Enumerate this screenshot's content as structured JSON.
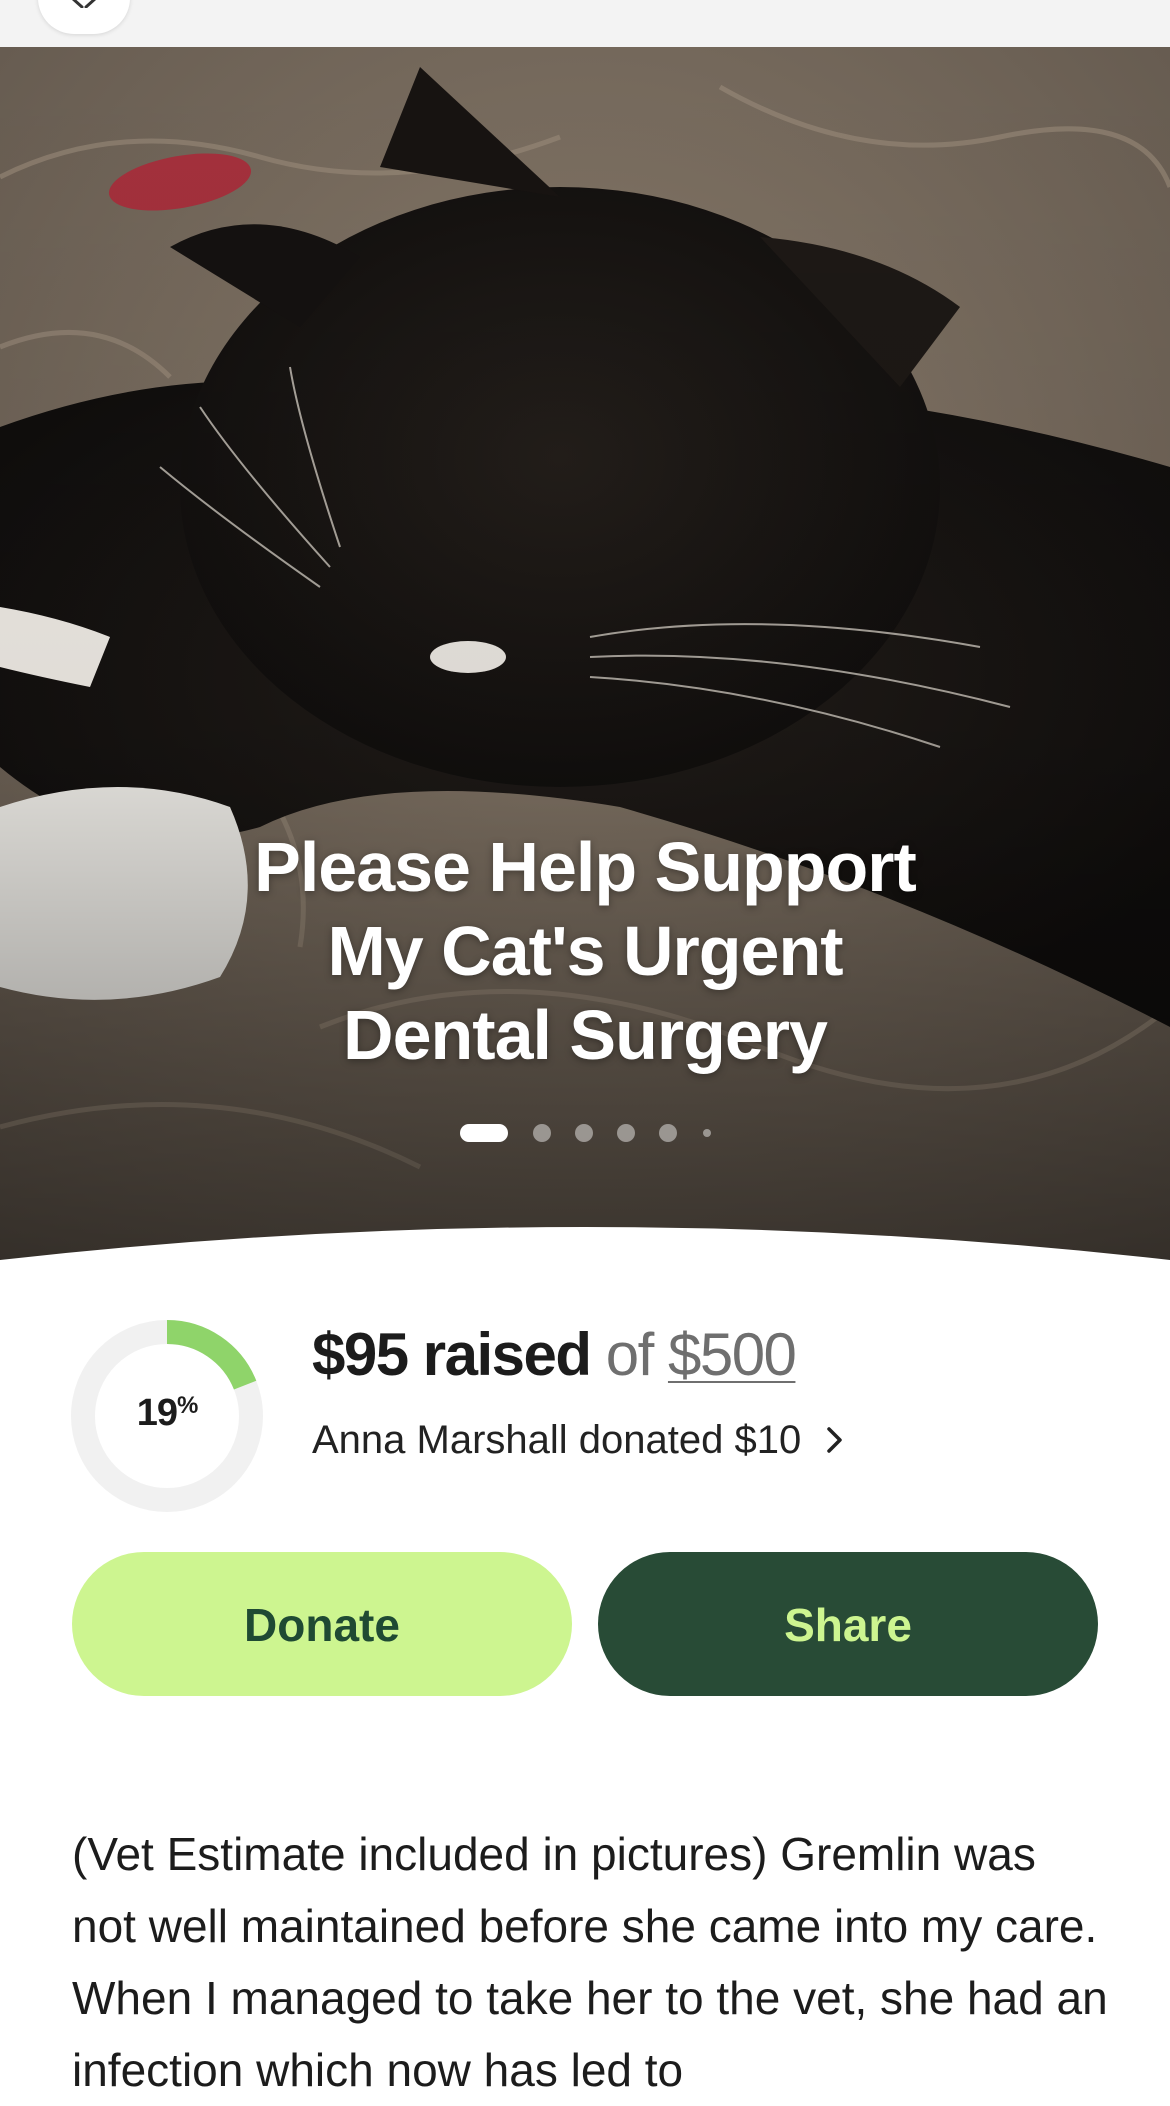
{
  "header": {
    "close_icon": "close-icon"
  },
  "hero": {
    "title_lines": [
      "Please Help Support",
      "My Cat's Urgent",
      "Dental Surgery"
    ],
    "carousel": {
      "total_slides": 6,
      "current_slide": 1
    }
  },
  "fundraiser": {
    "percent": "19",
    "percent_sign": "%",
    "progress_fraction": 0.19,
    "raised": "$95 raised",
    "of": "of",
    "goal": "$500",
    "recent_donation": "Anna Marshall donated $10"
  },
  "actions": {
    "donate_label": "Donate",
    "share_label": "Share"
  },
  "story": {
    "text": "(Vet Estimate included in pictures) Gremlin was not well maintained before she came into my care. When I managed to take her to the vet, she had an infection which now has led to"
  },
  "colors": {
    "accent_light": "#cdf590",
    "accent_dark": "#284b36",
    "progress": "#8fd46a",
    "ring_track": "#f1f1f1"
  }
}
